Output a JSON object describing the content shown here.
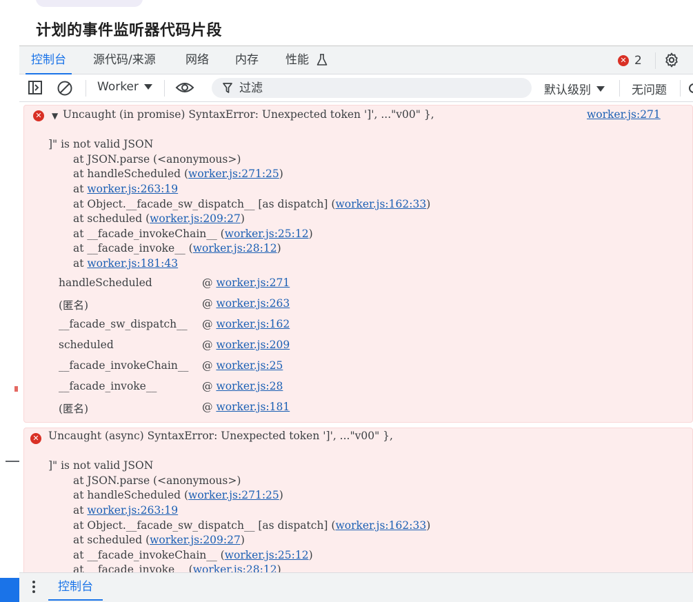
{
  "page": {
    "title": "计划的事件监听器代码片段"
  },
  "tabs": [
    {
      "label": "控制台",
      "active": true
    },
    {
      "label": "源代码/来源",
      "active": false
    },
    {
      "label": "网络",
      "active": false
    },
    {
      "label": "内存",
      "active": false
    },
    {
      "label": "性能",
      "active": false
    }
  ],
  "error_count": "2",
  "toolbar": {
    "context": "Worker",
    "filter_placeholder": "过滤",
    "levels": "默认级别",
    "issues": "无问题"
  },
  "messages": [
    {
      "icon": "error-icon",
      "header": "Uncaught (in promise) SyntaxError: Unexpected token ']', ...\"v00\" },",
      "source": "worker.js:271",
      "second_line": "]\" is not valid JSON",
      "stack": [
        {
          "pre": "at JSON.parse (<anonymous>)",
          "link": "",
          "post": ""
        },
        {
          "pre": "at handleScheduled (",
          "link": "worker.js:271:25",
          "post": ")"
        },
        {
          "pre": "at ",
          "link": "worker.js:263:19",
          "post": ""
        },
        {
          "pre": "at Object.__facade_sw_dispatch__ [as dispatch] (",
          "link": "worker.js:162:33",
          "post": ")"
        },
        {
          "pre": "at scheduled (",
          "link": "worker.js:209:27",
          "post": ")"
        },
        {
          "pre": "at __facade_invokeChain__ (",
          "link": "worker.js:25:12",
          "post": ")"
        },
        {
          "pre": "at __facade_invoke__ (",
          "link": "worker.js:28:12",
          "post": ")"
        },
        {
          "pre": "at ",
          "link": "worker.js:181:43",
          "post": ""
        }
      ],
      "async_stack": [
        {
          "fn": "handleScheduled",
          "link": "worker.js:271"
        },
        {
          "fn": "(匿名)",
          "link": "worker.js:263"
        },
        {
          "fn": "__facade_sw_dispatch__",
          "link": "worker.js:162"
        },
        {
          "fn": "scheduled",
          "link": "worker.js:209"
        },
        {
          "fn": "__facade_invokeChain__",
          "link": "worker.js:25"
        },
        {
          "fn": "__facade_invoke__",
          "link": "worker.js:28"
        },
        {
          "fn": "(匿名)",
          "link": "worker.js:181"
        }
      ]
    },
    {
      "icon": "error-icon",
      "header": "Uncaught (async) SyntaxError: Unexpected token ']', ...\"v00\" },",
      "second_line": "]\" is not valid JSON",
      "stack": [
        {
          "pre": "at JSON.parse (<anonymous>)",
          "link": "",
          "post": ""
        },
        {
          "pre": "at handleScheduled (",
          "link": "worker.js:271:25",
          "post": ")"
        },
        {
          "pre": "at ",
          "link": "worker.js:263:19",
          "post": ""
        },
        {
          "pre": "at Object.__facade_sw_dispatch__ [as dispatch] (",
          "link": "worker.js:162:33",
          "post": ")"
        },
        {
          "pre": "at scheduled (",
          "link": "worker.js:209:27",
          "post": ")"
        },
        {
          "pre": "at __facade_invokeChain__ (",
          "link": "worker.js:25:12",
          "post": ")"
        },
        {
          "pre": "at __facade_invoke__ (",
          "link": "worker.js:28:12",
          "post": ")"
        }
      ]
    }
  ],
  "drawer": {
    "tab_label": "控制台"
  },
  "colors": {
    "accent": "#1a73e8",
    "error": "#d93025",
    "error_bg": "#fdeded",
    "link": "#1a5fb4"
  }
}
